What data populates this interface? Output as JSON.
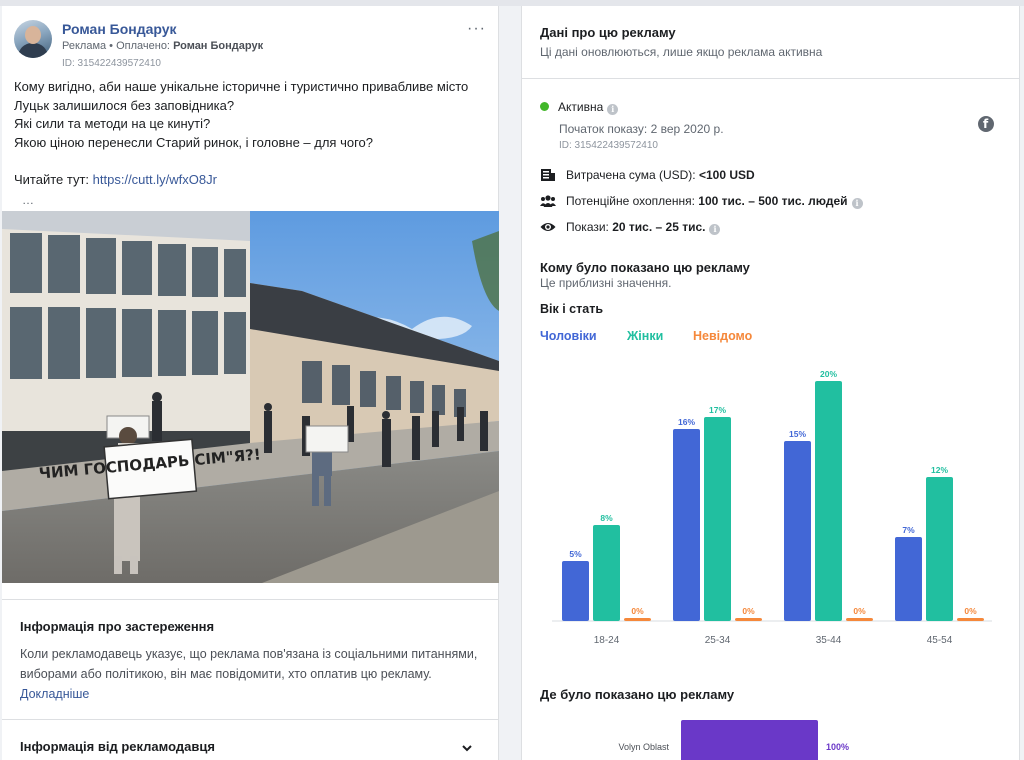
{
  "post": {
    "author": "Роман Бондарук",
    "meta_prefix": "Реклама • Оплачено: ",
    "meta_payer": "Роман Бондарук",
    "id": "ID: 315422439572410",
    "more_label": "···",
    "text_lines": [
      "Кому вигідно, аби наше унікальне історичне і туристично привабливе місто",
      "Луцьк залишилося без заповідника?",
      "Які сили та методи на це кинуті?",
      "Якою ціною перенесли Старий ринок, і головне – для чого?"
    ],
    "read_prefix": "Читайте тут: ",
    "link": "https://cutt.ly/wfxO8Jr",
    "ellipsis": "…",
    "photo_signs": [
      "ЧИМ ГОСПОДАРЬ СІМ\"Я?!"
    ]
  },
  "disclaimer": {
    "title": "Інформація про застереження",
    "body": "Коли рекламодавець указує, що реклама пов'язана із соціальними питаннями, виборами або політикою, він має повідомити, хто оплатив цю рекламу.",
    "more_link": "Докладніше"
  },
  "advertiser_info": {
    "title": "Інформація від рекламодавця"
  },
  "ad_data": {
    "title": "Дані про цю рекламу",
    "subtitle": "Ці дані оновлюються, лише якщо реклама активна",
    "status": "Активна",
    "start": "Початок показу: 2 вер 2020 р.",
    "id": "ID: 315422439572410",
    "spent_label": "Витрачена сума (USD):",
    "spent_value": "<100 USD",
    "reach_label": "Потенційне охоплення:",
    "reach_value": "100 тис. – 500 тис. людей",
    "impressions_label": "Покази:",
    "impressions_value": "20 тис. – 25 тис.",
    "audience_title": "Кому було показано цю рекламу",
    "audience_sub": "Це приблизні значення.",
    "age_gender_title": "Вік і стать",
    "where_title": "Де було показано цю рекламу"
  },
  "colors": {
    "men": "#4267d6",
    "women": "#21bfa0",
    "unknown": "#f5883b",
    "region": "#6a38c8",
    "link": "#385898",
    "active": "#42b72a"
  },
  "icons": [
    "facebook-icon",
    "info-icon",
    "money-icon",
    "people-icon",
    "eye-icon",
    "chevron-down-icon",
    "more-icon"
  ],
  "chart_data": [
    {
      "type": "bar",
      "title": "Вік і стать",
      "legend": [
        "Чоловіки",
        "Жінки",
        "Невідомо"
      ],
      "categories": [
        "18-24",
        "25-34",
        "35-44",
        "45-54"
      ],
      "series": [
        {
          "name": "Чоловіки",
          "values": [
            5,
            16,
            15,
            7
          ]
        },
        {
          "name": "Жінки",
          "values": [
            8,
            17,
            20,
            12
          ]
        },
        {
          "name": "Невідомо",
          "values": [
            0,
            0,
            0,
            0
          ]
        }
      ],
      "value_suffix": "%",
      "ylim": [
        0,
        20
      ],
      "grid": false
    },
    {
      "type": "bar",
      "title": "Де було показано цю рекламу",
      "orientation": "horizontal",
      "categories": [
        "Volyn Oblast"
      ],
      "values": [
        100
      ],
      "value_suffix": "%",
      "xlim": [
        0,
        100
      ]
    }
  ]
}
